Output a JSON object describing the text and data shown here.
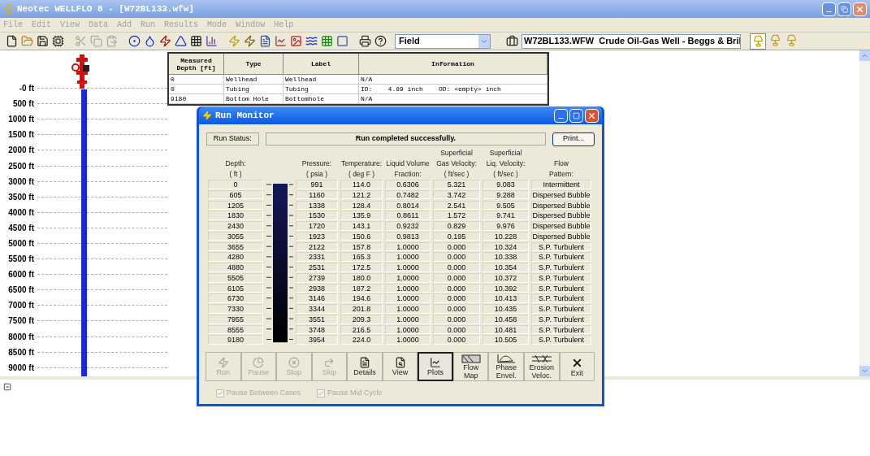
{
  "window": {
    "title": "Neotec WELLFLO 8 - [W72BL133.wfw]"
  },
  "menu": [
    "File",
    "Edit",
    "View",
    "Data",
    "Add",
    "Run",
    "Results",
    "Mode",
    "Window",
    "Help"
  ],
  "toolbar": {
    "mode": "Field",
    "well_description": "W72BL133.WFW  Crude Oil-Gas Well - Beggs & Bril"
  },
  "well_table": {
    "columns": [
      "Measured Depth [ft]",
      "Type",
      "Label",
      "Information"
    ],
    "rows": [
      [
        "0",
        "Wellhead",
        "Wellhead",
        "N/A"
      ],
      [
        "0",
        "Tubing",
        "Tubing",
        "ID:    4.89 inch    OD: <empty> inch"
      ],
      [
        "9180",
        "Bottom Hole",
        "Bottomhole",
        "N/A"
      ]
    ]
  },
  "depth_scale": [
    "-0 ft",
    "500 ft",
    "1000 ft",
    "1500 ft",
    "2000 ft",
    "2500 ft",
    "3000 ft",
    "3500 ft",
    "4000 ft",
    "4500 ft",
    "5000 ft",
    "5500 ft",
    "6000 ft",
    "6500 ft",
    "7000 ft",
    "7500 ft",
    "8000 ft",
    "8500 ft",
    "9000 ft"
  ],
  "run_monitor": {
    "title": "Run Monitor",
    "status_label": "Run Status:",
    "status": "Run completed successfully.",
    "print_button": "Print...",
    "columns": [
      {
        "lines": [
          "Depth:",
          "( ft )"
        ]
      },
      {
        "lines": [
          "Pressure:",
          "( psia )"
        ]
      },
      {
        "lines": [
          "Temperature:",
          "( deg F )"
        ]
      },
      {
        "lines": [
          "Liquid Volume",
          "Fraction:"
        ]
      },
      {
        "lines": [
          "Superficial",
          "Gas Velocity:",
          "( ft/sec )"
        ]
      },
      {
        "lines": [
          "Superficial",
          "Liq. Velocity:",
          "( ft/sec )"
        ]
      },
      {
        "lines": [
          "Flow",
          "Pattern:"
        ]
      }
    ],
    "rows": [
      [
        "0",
        "991",
        "114.0",
        "0.6306",
        "5.321",
        "9.083",
        "Intermittent"
      ],
      [
        "605",
        "1160",
        "121.2",
        "0.7482",
        "3.742",
        "9.288",
        "Dispersed Bubble"
      ],
      [
        "1205",
        "1338",
        "128.4",
        "0.8014",
        "2.541",
        "9.505",
        "Dispersed Bubble"
      ],
      [
        "1830",
        "1530",
        "135.9",
        "0.8611",
        "1.572",
        "9.741",
        "Dispersed Bubble"
      ],
      [
        "2430",
        "1720",
        "143.1",
        "0.9232",
        "0.829",
        "9.976",
        "Dispersed Bubble"
      ],
      [
        "3055",
        "1923",
        "150.6",
        "0.9813",
        "0.195",
        "10.228",
        "Dispersed Bubble"
      ],
      [
        "3655",
        "2122",
        "157.8",
        "1.0000",
        "0.000",
        "10.324",
        "S.P. Turbulent"
      ],
      [
        "4280",
        "2331",
        "165.3",
        "1.0000",
        "0.000",
        "10.338",
        "S.P. Turbulent"
      ],
      [
        "4880",
        "2531",
        "172.5",
        "1.0000",
        "0.000",
        "10.354",
        "S.P. Turbulent"
      ],
      [
        "5505",
        "2739",
        "180.0",
        "1.0000",
        "0.000",
        "10.372",
        "S.P. Turbulent"
      ],
      [
        "6105",
        "2938",
        "187.2",
        "1.0000",
        "0.000",
        "10.392",
        "S.P. Turbulent"
      ],
      [
        "6730",
        "3146",
        "194.6",
        "1.0000",
        "0.000",
        "10.413",
        "S.P. Turbulent"
      ],
      [
        "7330",
        "3344",
        "201.8",
        "1.0000",
        "0.000",
        "10.435",
        "S.P. Turbulent"
      ],
      [
        "7955",
        "3551",
        "209.3",
        "1.0000",
        "0.000",
        "10.458",
        "S.P. Turbulent"
      ],
      [
        "8555",
        "3748",
        "216.5",
        "1.0000",
        "0.000",
        "10.481",
        "S.P. Turbulent"
      ],
      [
        "9180",
        "3954",
        "224.0",
        "1.0000",
        "0.000",
        "10.505",
        "S.P. Turbulent"
      ]
    ],
    "buttons": [
      {
        "lines": [
          "Run"
        ],
        "disabled": true,
        "selected": false
      },
      {
        "lines": [
          "Pause"
        ],
        "disabled": true,
        "selected": false
      },
      {
        "lines": [
          "Stop"
        ],
        "disabled": true,
        "selected": false
      },
      {
        "lines": [
          "Skip"
        ],
        "disabled": true,
        "selected": false
      },
      {
        "lines": [
          "Details"
        ],
        "disabled": false,
        "selected": false
      },
      {
        "lines": [
          "View"
        ],
        "disabled": false,
        "selected": false
      },
      {
        "lines": [
          "Plots"
        ],
        "disabled": false,
        "selected": true
      },
      {
        "lines": [
          "Flow",
          "Map"
        ],
        "disabled": false,
        "selected": false
      },
      {
        "lines": [
          "Phase",
          "Envel."
        ],
        "disabled": false,
        "selected": false
      },
      {
        "lines": [
          "Erosion",
          "Veloc."
        ],
        "disabled": false,
        "selected": false
      },
      {
        "lines": [
          "Exit"
        ],
        "disabled": false,
        "selected": false
      }
    ],
    "options": [
      {
        "label": "Pause Between Cases",
        "checked": true,
        "disabled": true
      },
      {
        "label": "Pause Mid Cycle",
        "checked": true,
        "disabled": true
      }
    ]
  }
}
